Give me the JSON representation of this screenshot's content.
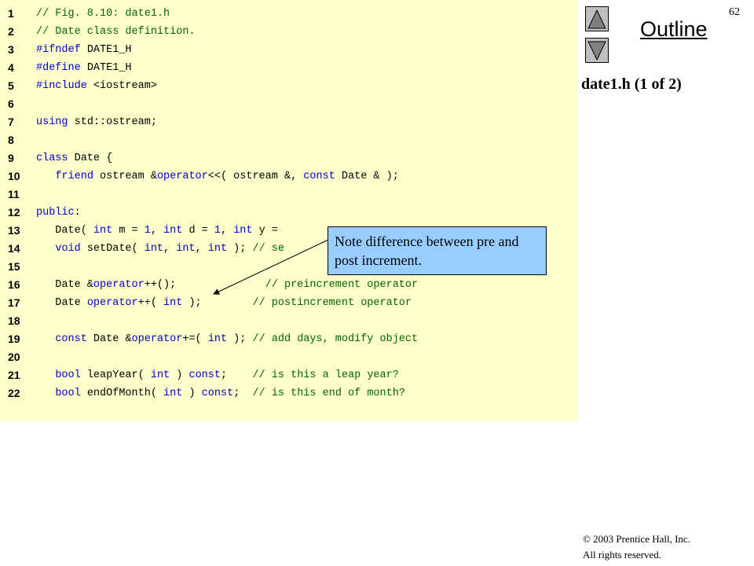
{
  "page_number": "62",
  "outline_label": "Outline",
  "file_title": "date1.h (1 of 2)",
  "callout_text": "Note difference between pre and post increment.",
  "copyright": {
    "line1": "© 2003 Prentice Hall, Inc.",
    "line2": "All rights reserved."
  },
  "nav": {
    "up_icon": "triangle-up-icon",
    "down_icon": "triangle-down-icon"
  },
  "colors": {
    "code_background": "#ffffcc",
    "callout_background": "#99ccff",
    "keyword": "#0000cc",
    "comment": "#006600"
  },
  "code_lines": [
    {
      "n": "1",
      "segments": [
        [
          "// Fig. 8.10: date1.h",
          "cmt"
        ]
      ]
    },
    {
      "n": "2",
      "segments": [
        [
          "// Date class definition.",
          "cmt"
        ]
      ]
    },
    {
      "n": "3",
      "segments": [
        [
          "#ifndef",
          "pp"
        ],
        [
          " DATE1_H",
          "txt"
        ]
      ]
    },
    {
      "n": "4",
      "segments": [
        [
          "#define",
          "pp"
        ],
        [
          " DATE1_H",
          "txt"
        ]
      ]
    },
    {
      "n": "5",
      "segments": [
        [
          "#include",
          "pp"
        ],
        [
          " <iostream>",
          "txt"
        ]
      ]
    },
    {
      "n": "6",
      "segments": []
    },
    {
      "n": "7",
      "segments": [
        [
          "using",
          "kw"
        ],
        [
          " std::ostream;",
          "txt"
        ]
      ]
    },
    {
      "n": "8",
      "segments": []
    },
    {
      "n": "9",
      "segments": [
        [
          "class",
          "kw"
        ],
        [
          " Date {",
          "txt"
        ]
      ]
    },
    {
      "n": "10",
      "segments": [
        [
          "   ",
          "txt"
        ],
        [
          "friend",
          "kw"
        ],
        [
          " ostream &",
          "txt"
        ],
        [
          "operator",
          "kw"
        ],
        [
          "<<( ostream &, ",
          "txt"
        ],
        [
          "const",
          "kw"
        ],
        [
          " Date & );",
          "txt"
        ]
      ]
    },
    {
      "n": "11",
      "segments": []
    },
    {
      "n": "12",
      "segments": [
        [
          "public",
          "kw"
        ],
        [
          ":",
          "txt"
        ]
      ]
    },
    {
      "n": "13",
      "segments": [
        [
          "   Date( ",
          "txt"
        ],
        [
          "int",
          "kw"
        ],
        [
          " m = ",
          "txt"
        ],
        [
          "1",
          "num"
        ],
        [
          ", ",
          "txt"
        ],
        [
          "int",
          "kw"
        ],
        [
          " d = ",
          "txt"
        ],
        [
          "1",
          "num"
        ],
        [
          ", ",
          "txt"
        ],
        [
          "int",
          "kw"
        ],
        [
          " y = ",
          "txt"
        ]
      ]
    },
    {
      "n": "14",
      "segments": [
        [
          "   ",
          "txt"
        ],
        [
          "void",
          "kw"
        ],
        [
          " setDate( ",
          "txt"
        ],
        [
          "int",
          "kw"
        ],
        [
          ", ",
          "txt"
        ],
        [
          "int",
          "kw"
        ],
        [
          ", ",
          "txt"
        ],
        [
          "int",
          "kw"
        ],
        [
          " ); ",
          "txt"
        ],
        [
          "// se",
          "cmt"
        ]
      ]
    },
    {
      "n": "15",
      "segments": []
    },
    {
      "n": "16",
      "segments": [
        [
          "   Date &",
          "txt"
        ],
        [
          "operator",
          "kw"
        ],
        [
          "++();              ",
          "txt"
        ],
        [
          "// preincrement operator",
          "cmt"
        ]
      ]
    },
    {
      "n": "17",
      "segments": [
        [
          "   Date ",
          "txt"
        ],
        [
          "operator",
          "kw"
        ],
        [
          "++( ",
          "txt"
        ],
        [
          "int",
          "kw"
        ],
        [
          " );        ",
          "txt"
        ],
        [
          "// postincrement operator",
          "cmt"
        ]
      ]
    },
    {
      "n": "18",
      "segments": []
    },
    {
      "n": "19",
      "segments": [
        [
          "   ",
          "txt"
        ],
        [
          "const",
          "kw"
        ],
        [
          " Date &",
          "txt"
        ],
        [
          "operator",
          "kw"
        ],
        [
          "+=( ",
          "txt"
        ],
        [
          "int",
          "kw"
        ],
        [
          " ); ",
          "txt"
        ],
        [
          "// add days, modify object",
          "cmt"
        ]
      ]
    },
    {
      "n": "20",
      "segments": []
    },
    {
      "n": "21",
      "segments": [
        [
          "   ",
          "txt"
        ],
        [
          "bool",
          "kw"
        ],
        [
          " leapYear( ",
          "txt"
        ],
        [
          "int",
          "kw"
        ],
        [
          " ) ",
          "txt"
        ],
        [
          "const",
          "kw"
        ],
        [
          ";    ",
          "txt"
        ],
        [
          "// is this a leap year?",
          "cmt"
        ]
      ]
    },
    {
      "n": "22",
      "segments": [
        [
          "   ",
          "txt"
        ],
        [
          "bool",
          "kw"
        ],
        [
          " endOfMonth( ",
          "txt"
        ],
        [
          "int",
          "kw"
        ],
        [
          " ) ",
          "txt"
        ],
        [
          "const",
          "kw"
        ],
        [
          ";  ",
          "txt"
        ],
        [
          "// is this end of month?",
          "cmt"
        ]
      ]
    }
  ]
}
